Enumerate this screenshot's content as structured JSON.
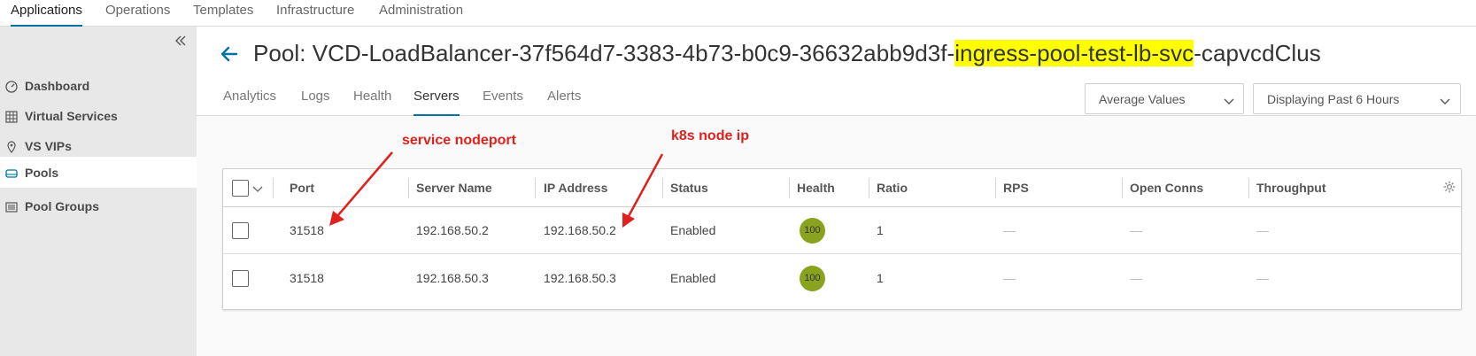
{
  "topnav": {
    "items": [
      {
        "label": "Applications",
        "active": true
      },
      {
        "label": "Operations"
      },
      {
        "label": "Templates"
      },
      {
        "label": "Infrastructure"
      },
      {
        "label": "Administration"
      }
    ]
  },
  "sidebar": {
    "collapse_icon": "double-chevron-left-icon",
    "items": [
      {
        "label": "Dashboard",
        "icon": "gauge-icon"
      },
      {
        "label": "Virtual Services",
        "icon": "grid-icon"
      },
      {
        "label": "VS VIPs",
        "icon": "location-pin-icon"
      },
      {
        "label": "Pools",
        "icon": "server-icon",
        "active": true
      },
      {
        "label": "Pool Groups",
        "icon": "stack-icon"
      }
    ]
  },
  "header": {
    "title_prefix": "Pool: VCD-LoadBalancer-37f564d7-3383-4b73-b0c9-36632abb9d3f-",
    "title_highlight": "ingress-pool-test-lb-svc",
    "title_suffix": "-capvcdClus",
    "highlight_color": "#ffff00"
  },
  "tabs": [
    {
      "label": "Analytics"
    },
    {
      "label": "Logs"
    },
    {
      "label": "Health"
    },
    {
      "label": "Servers",
      "active": true
    },
    {
      "label": "Events"
    },
    {
      "label": "Alerts"
    }
  ],
  "dropdowns": {
    "values": "Average Values",
    "period": "Displaying Past 6 Hours"
  },
  "table": {
    "columns": [
      "Port",
      "Server Name",
      "IP Address",
      "Status",
      "Health",
      "Ratio",
      "RPS",
      "Open Conns",
      "Throughput"
    ],
    "rows": [
      {
        "port": "31518",
        "server_name": "192.168.50.2",
        "ip": "192.168.50.2",
        "status": "Enabled",
        "health": "100",
        "ratio": "1",
        "rps": "—",
        "open_conns": "—",
        "throughput": "—"
      },
      {
        "port": "31518",
        "server_name": "192.168.50.3",
        "ip": "192.168.50.3",
        "status": "Enabled",
        "health": "100",
        "ratio": "1",
        "rps": "—",
        "open_conns": "—",
        "throughput": "—"
      }
    ]
  },
  "annotations": {
    "nodeport": "service nodeport",
    "nodeip": "k8s node ip",
    "color": "#e0201c"
  },
  "colors": {
    "accent": "#0072a3",
    "health_good": "#8aa31f"
  }
}
